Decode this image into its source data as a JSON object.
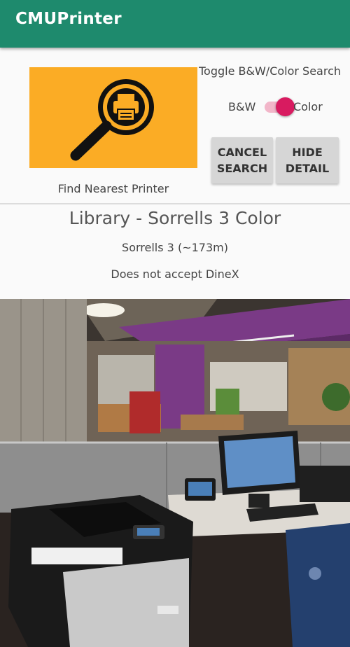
{
  "app": {
    "title": "CMUPrinter"
  },
  "find": {
    "label": "Find Nearest Printer",
    "icon": "magnifier-printer-icon"
  },
  "toggle": {
    "title": "Toggle B&W/Color Search",
    "bw_label": "B&W",
    "color_label": "Color",
    "state": "Color"
  },
  "buttons": {
    "cancel": "CANCEL\nSEARCH",
    "hide": "HIDE\nDETAIL"
  },
  "detail": {
    "title": "Library - Sorrells 3 Color",
    "subtitle": "Sorrells 3 (~173m)",
    "dinex": "Does not accept DineX"
  },
  "colors": {
    "appbar": "#1e8a6d",
    "find_button": "#fbac25",
    "switch_accent": "#d81b60"
  }
}
